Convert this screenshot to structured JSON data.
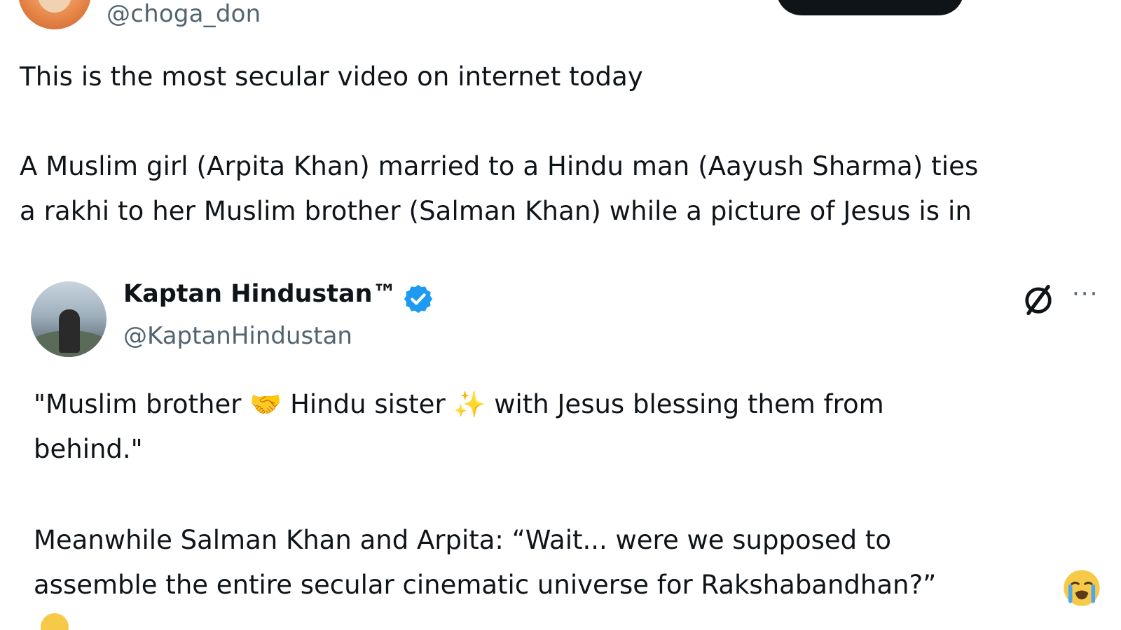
{
  "original_tweet": {
    "handle": "@choga_don",
    "text_lines": [
      "This is the most secular video on internet today",
      "A Muslim girl (Arpita Khan) married to a Hindu man (Aayush Sharma) ties",
      "a rakhi to her Muslim brother (Salman Khan) while a picture of Jesus is in"
    ]
  },
  "quoted_tweet": {
    "name": "Kaptan Hindustan™",
    "handle": "@KaptanHindustan",
    "verified": true,
    "line1_a": "\"Muslim brother ",
    "line1_emoji1": "🤝",
    "line1_b": " Hindu sister ",
    "line1_emoji2": "✨",
    "line1_c": " with Jesus blessing them from",
    "line2": "behind.\"",
    "line3": "Meanwhile Salman Khan and Arpita: “Wait... were we supposed to",
    "line4": "assemble the entire secular cinematic universe for Rakshabandhan?”",
    "more_label": "···"
  },
  "colors": {
    "text": "#0f1419",
    "secondary": "#536471",
    "verified_blue": "#1d9bf0",
    "follow_button": "#0f1419"
  },
  "icons": [
    "verified-badge-icon",
    "grok-icon",
    "more-icon",
    "handshake-icon",
    "sparkles-icon",
    "crying-face-icon"
  ]
}
